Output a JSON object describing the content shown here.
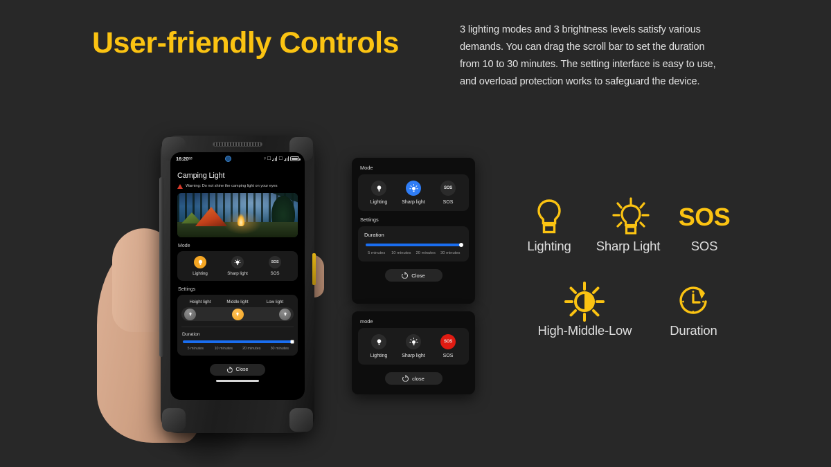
{
  "header": {
    "title": "User-friendly Controls",
    "paragraph": "3 lighting modes and 3 brightness levels satisfy various demands. You can drag the scroll bar to set the duration from 10 to 30 minutes. The setting interface is easy to use, and overload protection works to safeguard the device."
  },
  "colors": {
    "background": "#282828",
    "accent_yellow": "#FBC312",
    "amber": "#F5A623",
    "blue": "#2F7DF6",
    "red": "#E01B12",
    "slider_blue": "#1A6EF0",
    "text_light": "#DEDEDE"
  },
  "phone": {
    "status_bar": {
      "time": "16:20",
      "battery_icon": "battery-icon",
      "signal_icon": "signal-bars-icon",
      "wifi_icon": "wifi-icon"
    },
    "app_title": "Camping Light",
    "warning": "Warning: Do not shine the camping light on your eyes",
    "hero_image": "camping-night-scene",
    "mode_section": {
      "label": "Mode",
      "items": [
        {
          "label": "Lighting",
          "icon": "bulb-icon",
          "active": true
        },
        {
          "label": "Sharp light",
          "icon": "bulb-rays-icon",
          "active": false
        },
        {
          "label": "SOS",
          "icon": "sos-icon",
          "active": false
        }
      ]
    },
    "settings_section": {
      "label": "Settings",
      "brightness": {
        "options": [
          "Height light",
          "Middle light",
          "Low light"
        ],
        "active_index": 1
      },
      "duration": {
        "label": "Duration",
        "ticks": [
          "5 minutes",
          "10 minutes",
          "20 minutes",
          "30 minutes"
        ],
        "value_percent": 100
      }
    },
    "close_button": "Close"
  },
  "panel_a": {
    "mode_label": "Mode",
    "modes": [
      {
        "label": "Lighting",
        "icon": "bulb-icon",
        "state": "off"
      },
      {
        "label": "Sharp light",
        "icon": "bulb-rays-icon",
        "state": "blue"
      },
      {
        "label": "SOS",
        "icon": "sos-icon",
        "state": "off"
      }
    ],
    "settings_label": "Settings",
    "duration_label": "Duration",
    "duration_ticks": [
      "5 minutes",
      "10 minutes",
      "20 minutes",
      "30 minutes"
    ],
    "duration_percent": 100,
    "close_button": "Close"
  },
  "panel_b": {
    "mode_label": "mode",
    "modes": [
      {
        "label": "Lighting",
        "icon": "bulb-icon",
        "state": "off"
      },
      {
        "label": "Sharp light",
        "icon": "bulb-rays-icon",
        "state": "off"
      },
      {
        "label": "SOS",
        "icon": "sos-icon",
        "state": "red"
      }
    ],
    "close_button": "close"
  },
  "legend": {
    "row1": [
      {
        "icon": "bulb-outline-icon",
        "label": "Lighting"
      },
      {
        "icon": "bulb-rays-icon",
        "label": "Sharp Light"
      },
      {
        "icon": "sos-text-icon",
        "icon_text": "SOS",
        "label": "SOS"
      }
    ],
    "row2": [
      {
        "icon": "brightness-half-sun-icon",
        "label": "High-Middle-Low"
      },
      {
        "icon": "clock-arrow-icon",
        "label": "Duration"
      }
    ]
  }
}
